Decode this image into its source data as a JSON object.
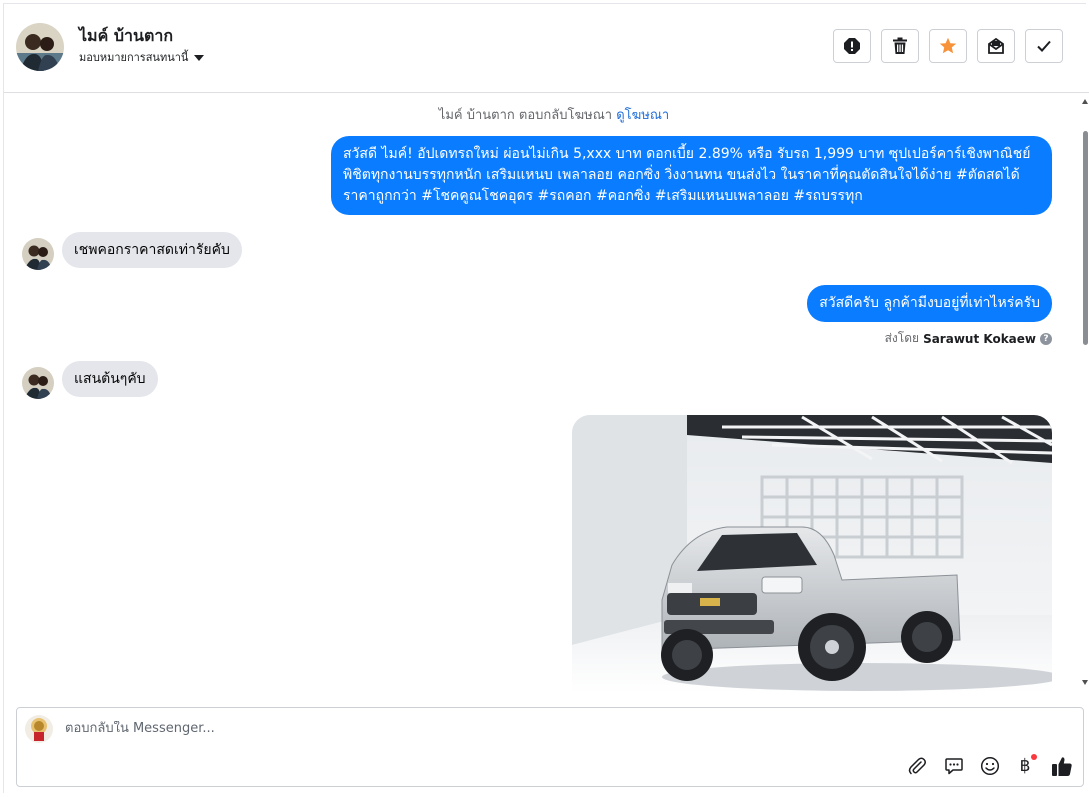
{
  "header": {
    "contact_name": "ไมค์ บ้านตาก",
    "assign_label": "มอบหมายการสนทนานี้",
    "actions": [
      "spam-alert-icon",
      "trash-icon",
      "star-icon",
      "mark-unread-icon",
      "done-check-icon"
    ]
  },
  "conversation": {
    "system_note": "ไมค์ บ้านตาก ตอบกลับโฆษณา",
    "system_note_link": "ดูโฆษณา",
    "messages": [
      {
        "from": "page",
        "text": "สวัสดี ไมค์! อัปเดทรถใหม่ ผ่อนไม่เกิน 5,xxx บาท ดอกเบี้ย 2.89% หรือ รับรถ 1,999 บาท ซุปเปอร์คาร์เชิงพาณิชย์ พิชิตทุกงานบรรทุกหนัก เสริมแหนบ เพลาลอย คอกซิ่ง วิ่งงานทน ขนส่งไว ในราคาที่คุณตัดสินใจได้ง่าย #ตัดสดได้ราคาถูกกว่า #โชคคูณโชคอุดร #รถคอก #คอกซิ่ง #เสริมแหนบเพลาลอย #รถบรรทุก"
      },
      {
        "from": "customer",
        "text": "เชพคอกราคาสดเท่ารัยคับ"
      },
      {
        "from": "page",
        "text": "สวัสดีครับ ลูกค้ามีงบอยู่ที่เท่าไหร่ครับ"
      },
      {
        "from": "customer",
        "text": "แสนต้นๆคับ"
      }
    ],
    "sent_by_prefix": "ส่งโดย",
    "sent_by_name": "Sarawut Kokaew",
    "help_glyph": "?"
  },
  "composer": {
    "placeholder": "ตอบกลับใน Messenger...",
    "value": "",
    "tools": [
      "attachment-icon",
      "saved-reply-icon",
      "emoji-icon",
      "payment-baht-icon",
      "like-thumb-icon"
    ],
    "baht_glyph": "฿",
    "thumb_color": "#1c1e21"
  },
  "colors": {
    "outgoing_bubble": "#0a7cff",
    "incoming_bubble": "#e4e6eb",
    "link": "#216fdb",
    "star": "#f7923b"
  }
}
